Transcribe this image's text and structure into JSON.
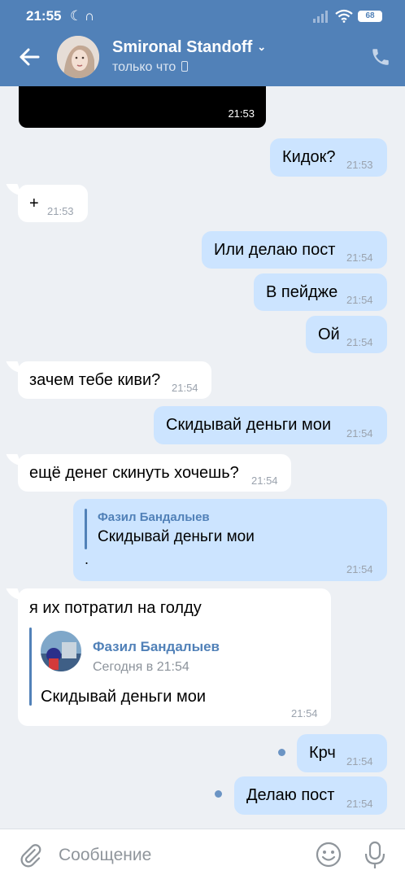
{
  "status": {
    "time": "21:55",
    "battery": "68"
  },
  "header": {
    "name": "Smironal Standoff",
    "status": "только что"
  },
  "video": {
    "time": "21:53"
  },
  "messages": [
    {
      "text": "Кидок?",
      "time": "21:53"
    },
    {
      "text": "+",
      "time": "21:53"
    },
    {
      "text": "Или делаю пост",
      "time": "21:54"
    },
    {
      "text": "В пейдже",
      "time": "21:54"
    },
    {
      "text": "Ой",
      "time": "21:54"
    },
    {
      "text": "зачем тебе киви?",
      "time": "21:54"
    },
    {
      "text": "Скидывай деньги мои",
      "time": "21:54"
    },
    {
      "text": "ещё денег скинуть хочешь?",
      "time": "21:54"
    },
    {
      "reply_name": "Фазил Бандалыев",
      "reply_text": "Скидывай деньги мои",
      "text": ".",
      "time": "21:54"
    },
    {
      "text": "я их потратил на голду",
      "fwd_name": "Фазил Бандалыев",
      "fwd_date": "Сегодня в 21:54",
      "fwd_text": "Скидывай деньги мои",
      "time": "21:54"
    },
    {
      "text": "Крч",
      "time": "21:54"
    },
    {
      "text": "Делаю пост",
      "time": "21:54"
    }
  ],
  "composer": {
    "placeholder": "Сообщение"
  },
  "colors": {
    "header": "#5181b8",
    "outgoing": "#cce4ff",
    "incoming": "#ffffff",
    "background": "#edf0f4"
  }
}
